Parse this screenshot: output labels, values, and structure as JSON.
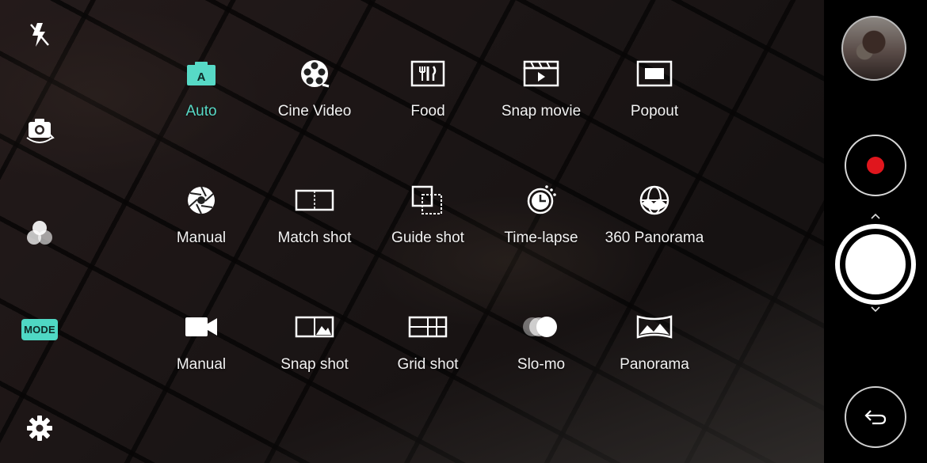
{
  "left_rail": {
    "flash_icon": "flash-off-icon",
    "switch_icon": "switch-camera-icon",
    "filter_icon": "filter-icon",
    "mode_label": "MODE",
    "settings_icon": "gear-icon"
  },
  "modes": {
    "row1": [
      {
        "label": "Auto",
        "icon": "auto-camera-icon",
        "active": true
      },
      {
        "label": "Cine Video",
        "icon": "film-reel-icon"
      },
      {
        "label": "Food",
        "icon": "food-icon"
      },
      {
        "label": "Snap movie",
        "icon": "clapper-icon"
      },
      {
        "label": "Popout",
        "icon": "popout-icon"
      }
    ],
    "row2": [
      {
        "label": "Manual",
        "icon": "aperture-icon"
      },
      {
        "label": "Match shot",
        "icon": "match-shot-icon"
      },
      {
        "label": "Guide shot",
        "icon": "guide-shot-icon"
      },
      {
        "label": "Time-lapse",
        "icon": "timelapse-icon"
      },
      {
        "label": "360 Panorama",
        "icon": "globe-panorama-icon"
      }
    ],
    "row3": [
      {
        "label": "Manual",
        "icon": "video-camera-icon"
      },
      {
        "label": "Snap shot",
        "icon": "snap-shot-icon"
      },
      {
        "label": "Grid shot",
        "icon": "grid-shot-icon"
      },
      {
        "label": "Slo-mo",
        "icon": "slomo-icon"
      },
      {
        "label": "Panorama",
        "icon": "panorama-icon"
      }
    ]
  },
  "right_panel": {
    "gallery_thumb": "gallery-thumbnail",
    "record_icon": "record-icon",
    "shutter_icon": "shutter-button",
    "back_icon": "back-arrow-icon"
  },
  "colors": {
    "accent": "#57d9c6",
    "record": "#e0161d"
  }
}
